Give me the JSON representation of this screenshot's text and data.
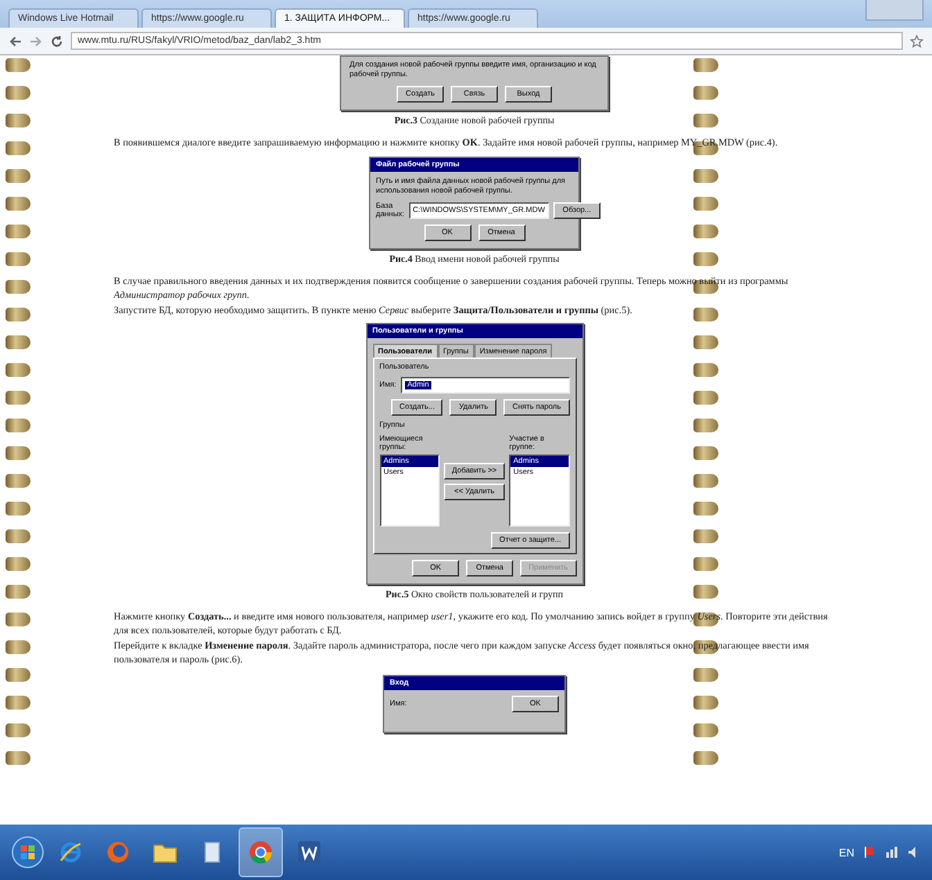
{
  "browser": {
    "tabs": [
      {
        "title": "Windows Live Hotmail",
        "selected": false
      },
      {
        "title": "https://www.google.ru",
        "selected": false
      },
      {
        "title": "1. ЗАЩИТА ИНФОРМ...",
        "selected": true
      },
      {
        "title": "https://www.google.ru",
        "selected": false
      }
    ],
    "url": "www.mtu.ru/RUS/fakyl/VRIO/metod/baz_dan/lab2_3.htm"
  },
  "fig3": {
    "text": "Для создания новой рабочей группы введите имя, организацию и код рабочей группы.",
    "buttons": [
      "Создать",
      "Связь",
      "Выход"
    ],
    "caption": "**Рис.3** Создание новой рабочей группы"
  },
  "para1": "В появившемся диалоге введите запрашиваемую информацию и нажмите кнопку **OK**. Задайте имя новой рабочей группы, например MY_GR.MDW (рис.4).",
  "fig4": {
    "title": "Файл рабочей группы",
    "text": "Путь и имя файла данных новой рабочей группы для использования новой рабочей группы.",
    "field_label": "База данных:",
    "value": "C:\\WINDOWS\\SYSTEM\\MY_GR.MDW",
    "browse": "Обзор...",
    "buttons": [
      "OK",
      "Отмена"
    ],
    "caption": "**Рис.4** Ввод имени новой рабочей группы"
  },
  "para2": "В случае правильного введения данных и их подтверждения появится сообщение о завершении создания рабочей группы. Теперь можно выйти из программы *Администратор рабочих групп*.",
  "para3": "Запустите БД, которую необходимо защитить. В пункте меню *Сервис* выберите **Защита/Пользователи и группы** (рис.5).",
  "fig5": {
    "title": "Пользователи и группы",
    "tabs": [
      {
        "label": "Пользователи",
        "selected": true
      },
      {
        "label": "Группы",
        "selected": false
      },
      {
        "label": "Изменение пароля",
        "selected": false
      }
    ],
    "user_group": "Пользователь",
    "name_label": "Имя:",
    "name_value": "Admin",
    "user_buttons": [
      "Создать...",
      "Удалить",
      "Снять пароль"
    ],
    "groups_group": "Группы",
    "available_label": "Имеющиеся группы:",
    "available": [
      {
        "label": "Admins",
        "selected": true
      },
      {
        "label": "Users",
        "selected": false
      }
    ],
    "add": "Добавить >>",
    "remove": "<< Удалить",
    "member_label": "Участие в группе:",
    "member": [
      {
        "label": "Admins",
        "selected": true
      },
      {
        "label": "Users",
        "selected": false
      }
    ],
    "report": "Отчет о защите...",
    "buttons": [
      {
        "label": "OK",
        "disabled": false
      },
      {
        "label": "Отмена",
        "disabled": false
      },
      {
        "label": "Применить",
        "disabled": true
      }
    ],
    "caption": "**Рис.5** Окно свойств пользователей и групп"
  },
  "para4": "Нажмите кнопку **Создать...** и введите имя нового пользователя, например *user1*, укажите его код. По умолчанию запись войдет в группу *Users*. Повторите эти действия для всех пользователей, которые будут работать с БД.",
  "para5": "Перейдите к вкладке **Изменение пароля**. Задайте пароль администратора, после чего при каждом запуске *Access* будет появляться окно, предлагающее ввести имя пользователя и пароль (рис.6).",
  "fig6": {
    "title": "Вход",
    "name_label": "Имя:",
    "button": "OK"
  },
  "taskbar": {
    "apps": [
      {
        "kind": "ie",
        "selected": false
      },
      {
        "kind": "firefox",
        "selected": false
      },
      {
        "kind": "folder",
        "selected": false
      },
      {
        "kind": "file",
        "selected": false
      },
      {
        "kind": "chrome",
        "selected": true
      },
      {
        "kind": "word",
        "selected": false
      }
    ],
    "language": "EN"
  }
}
